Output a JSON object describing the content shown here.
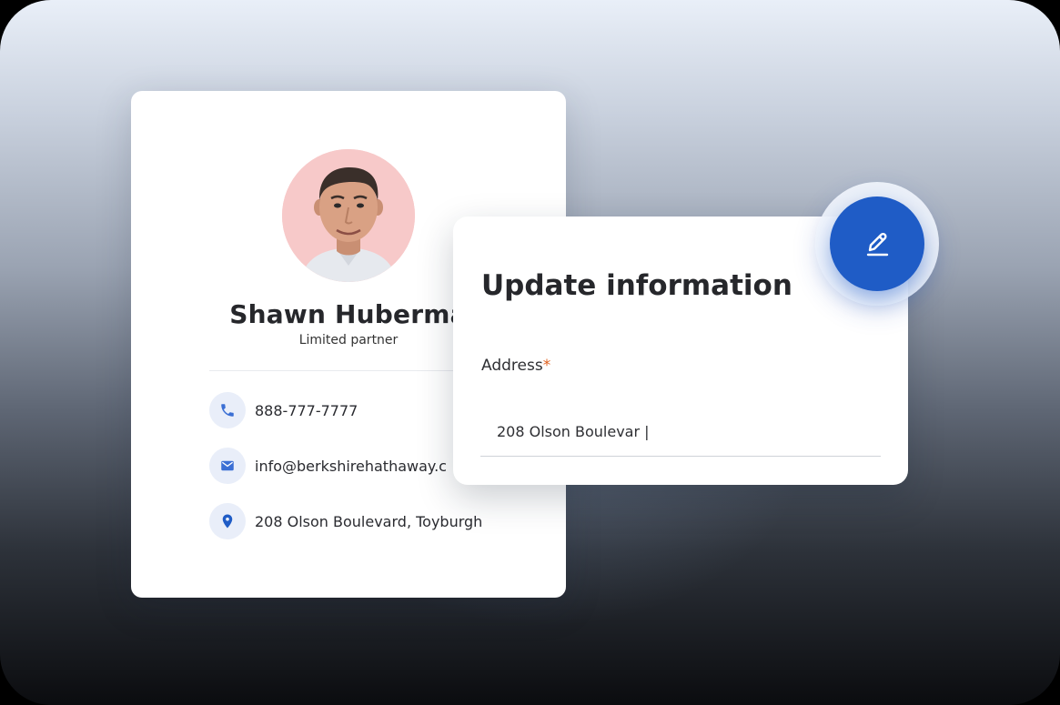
{
  "profile": {
    "name": "Shawn Huberma",
    "role": "Limited partner",
    "avatar_bg": "#f7c9c9",
    "contacts": [
      {
        "icon": "phone-icon",
        "text": "888-777-7777"
      },
      {
        "icon": "mail-icon",
        "text": "info@berkshirehathaway.c"
      },
      {
        "icon": "location-pin-icon",
        "text": "208 Olson Boulevard, Toyburgh"
      }
    ]
  },
  "update_form": {
    "title": "Update information",
    "address_label": "Address",
    "required_mark": "*",
    "address_value": "208 Olson Boulevar |"
  },
  "edit_button": {
    "icon": "pencil-icon",
    "color": "#1f5cc6"
  },
  "colors": {
    "accent": "#1f5cc6",
    "required": "#e0611f"
  }
}
